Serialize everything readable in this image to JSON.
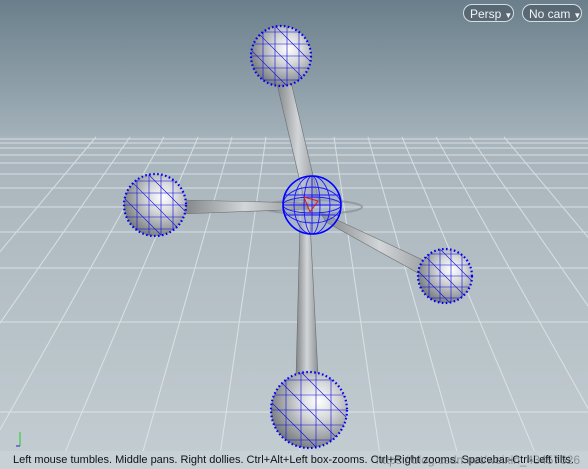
{
  "viewport": {
    "persp_label": "Persp",
    "nocam_label": "No cam",
    "caret_icon": "chevron-down-icon"
  },
  "status": {
    "text": "Left mouse tumbles. Middle pans. Right dollies. Ctrl+Alt+Left box-zooms. Ctrl+Right zooms. Spacebar-Ctrl-Left tilts."
  },
  "watermark": {
    "text": "https://blog.csdn.net/weixin_43457626"
  },
  "colors": {
    "sky_top": "#6f8490",
    "sky_bottom": "#b9c5cc",
    "ground": "#b4c0c6",
    "grid": "#e9eff2",
    "sphere_wire": "#0000ee",
    "arm": "#9a9a9a",
    "status_bg": "#c7d1d6"
  }
}
